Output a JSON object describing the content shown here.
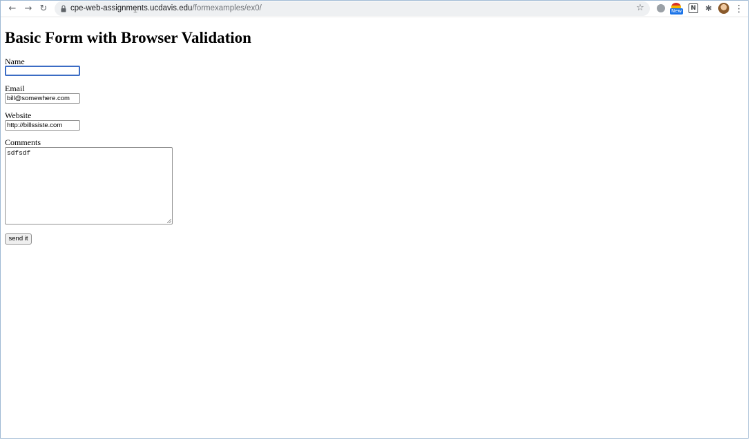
{
  "browser": {
    "url_host": "cpe-web-assignments.ucdavis.edu",
    "url_path": "/formexamples/ex0/",
    "icons": {
      "back": "back-arrow-icon",
      "forward": "forward-arrow-icon",
      "reload": "reload-icon",
      "lock": "lock-icon",
      "bookmark": "star-icon",
      "menu": "kebab-menu-icon"
    },
    "extension_badge": "New"
  },
  "page": {
    "title": "Basic Form with Browser Validation",
    "form": {
      "name_label": "Name",
      "name_value": "",
      "email_label": "Email",
      "email_value": "bill@somewhere.com",
      "website_label": "Website",
      "website_value": "http://billssiste.com",
      "comments_label": "Comments",
      "comments_value": "sdfsdf",
      "submit_label": "send it"
    }
  },
  "colors": {
    "focus_ring": "#3b6cc4",
    "window_border": "#9db8d3"
  }
}
